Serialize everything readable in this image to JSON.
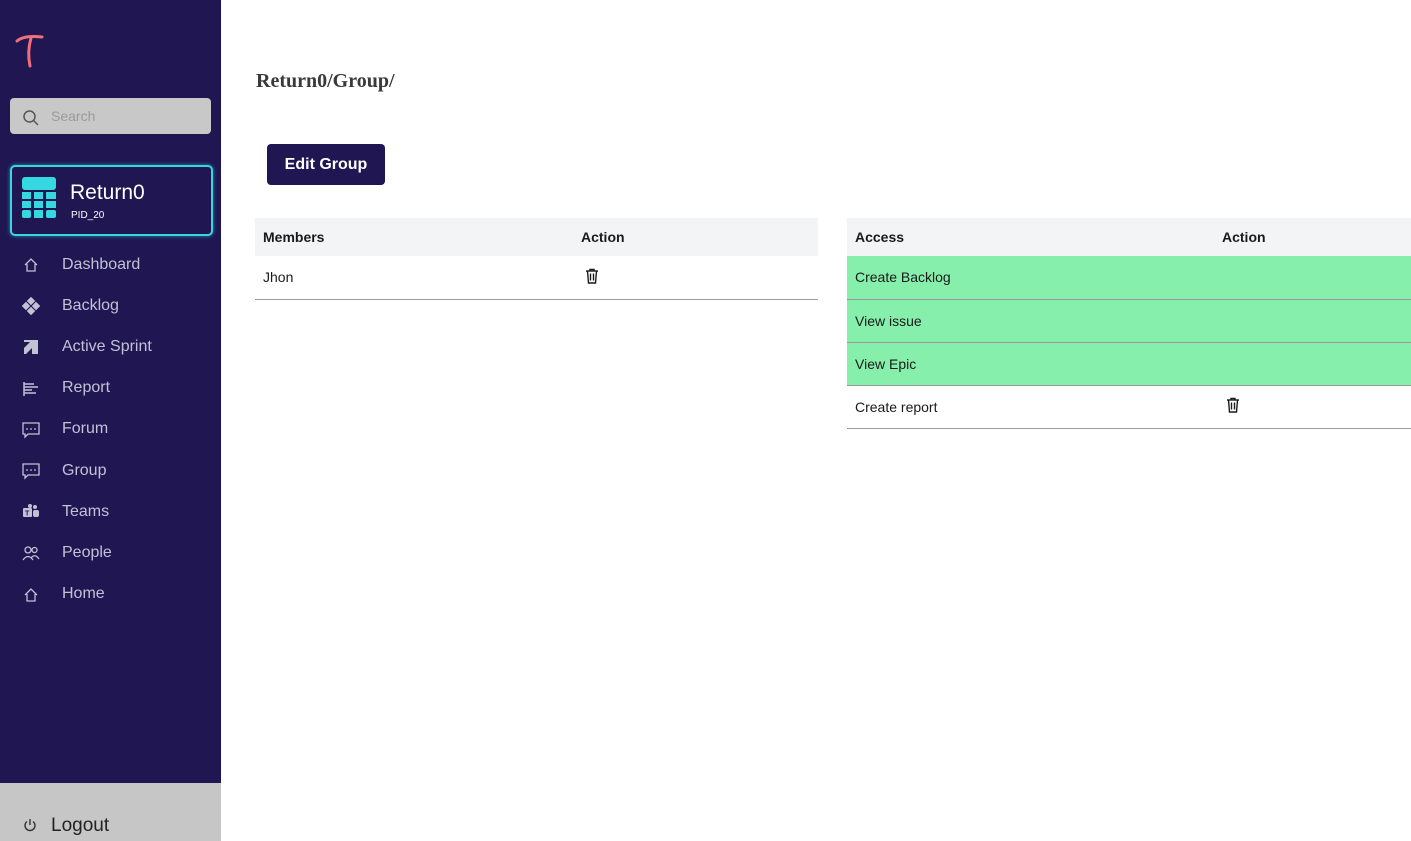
{
  "app": {
    "logo_text": "T",
    "search_placeholder": "Search"
  },
  "project": {
    "name": "Return0",
    "id": "PID_20"
  },
  "sidebar": {
    "items": [
      {
        "label": "Dashboard",
        "icon": "home-icon"
      },
      {
        "label": "Backlog",
        "icon": "diamond-grid-icon"
      },
      {
        "label": "Active Sprint",
        "icon": "sprint-icon"
      },
      {
        "label": "Report",
        "icon": "report-icon"
      },
      {
        "label": "Forum",
        "icon": "chat-icon"
      },
      {
        "label": "Group",
        "icon": "chat-icon"
      },
      {
        "label": "Teams",
        "icon": "teams-icon"
      },
      {
        "label": "People",
        "icon": "people-icon"
      },
      {
        "label": "Home",
        "icon": "home-icon"
      }
    ],
    "logout_label": "Logout"
  },
  "main": {
    "breadcrumb": "Return0/Group/",
    "edit_button": "Edit Group",
    "members_table": {
      "headers": [
        "Members",
        "Action"
      ],
      "rows": [
        {
          "member": "Jhon",
          "action": "delete"
        }
      ]
    },
    "access_table": {
      "headers": [
        "Access",
        "Action"
      ],
      "rows": [
        {
          "access": "Create Backlog",
          "granted": true
        },
        {
          "access": "View issue",
          "granted": true
        },
        {
          "access": "View Epic",
          "granted": true
        },
        {
          "access": "Create report",
          "granted": false,
          "action": "delete"
        }
      ]
    }
  },
  "colors": {
    "sidebar_bg": "#1f1652",
    "accent_cyan": "#35d7e0",
    "granted_row": "#86efac",
    "logo": "#f0707a"
  }
}
